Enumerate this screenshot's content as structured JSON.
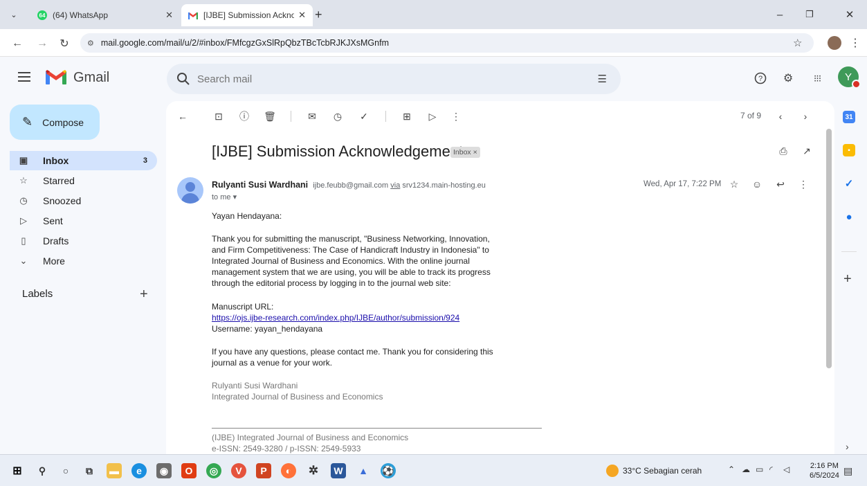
{
  "browser": {
    "tabs": [
      {
        "title": "(64) WhatsApp",
        "badge": "64",
        "icon": "whatsapp-icon"
      },
      {
        "title": "[IJBE] Submission Acknowledge",
        "icon": "gmail-icon"
      }
    ],
    "url": "mail.google.com/mail/u/2/#inbox/FMfcgzGxSlRpQbzTBcTcbRJKJXsMGnfm"
  },
  "gmail": {
    "app_name": "Gmail",
    "search_placeholder": "Search mail",
    "avatar_letter": "Y",
    "compose_label": "Compose",
    "nav": [
      {
        "label": "Inbox",
        "count": "3",
        "icon": "inbox-icon"
      },
      {
        "label": "Starred",
        "count": "",
        "icon": "star-icon"
      },
      {
        "label": "Snoozed",
        "count": "",
        "icon": "clock-icon"
      },
      {
        "label": "Sent",
        "count": "",
        "icon": "send-icon"
      },
      {
        "label": "Drafts",
        "count": "",
        "icon": "draft-icon"
      },
      {
        "label": "More",
        "count": "",
        "icon": "chevron-down-icon"
      }
    ],
    "labels_heading": "Labels"
  },
  "email": {
    "pager": "7 of 9",
    "subject": "[IJBE] Submission Acknowledgement",
    "label_chip": "Inbox ×",
    "sender_name": "Rulyanti Susi Wardhani",
    "sender_email": "ijbe.feubb@gmail.com",
    "via_text": "via",
    "via_host": "srv1234.main-hosting.eu",
    "to_line": "to me ▾",
    "date": "Wed, Apr 17, 7:22 PM",
    "body": {
      "greeting": "Yayan Hendayana:",
      "para1": [
        "Thank you for submitting the manuscript, \"Business Networking, Innovation,",
        "and  Firm Competitiveness: The Case of Handicraft Industry in Indonesia\" to",
        "Integrated Journal of Business and Economics. With the online journal",
        "management system that we are using, you will be able to track its progress",
        "through the editorial process by logging in to the journal web site:"
      ],
      "manuscript_url_label": "Manuscript URL:",
      "manuscript_url": "https://ojs.ijbe-research.com/index.php/IJBE/author/submission/924",
      "username_line": "Username: yayan_hendayana",
      "para2": [
        "If you have any questions, please contact me. Thank you for considering this",
        "journal as a venue for your work."
      ],
      "signature": [
        "Rulyanti Susi Wardhani",
        "Integrated Journal of Business and Economics"
      ],
      "footer": [
        "(IJBE) Integrated Journal of Business and Economics",
        "e-ISSN: 2549-3280 / p-ISSN: 2549-5933"
      ]
    }
  },
  "taskbar": {
    "weather": "33°C  Sebagian cerah",
    "time": "2:16 PM",
    "date": "6/5/2024"
  },
  "colors": {
    "compose_bg": "#c2e7ff",
    "inbox_active_bg": "#d3e3fd",
    "search_bg": "#e9eef6",
    "link": "#1a0dab",
    "avatar_bg": "#3f9a59"
  }
}
